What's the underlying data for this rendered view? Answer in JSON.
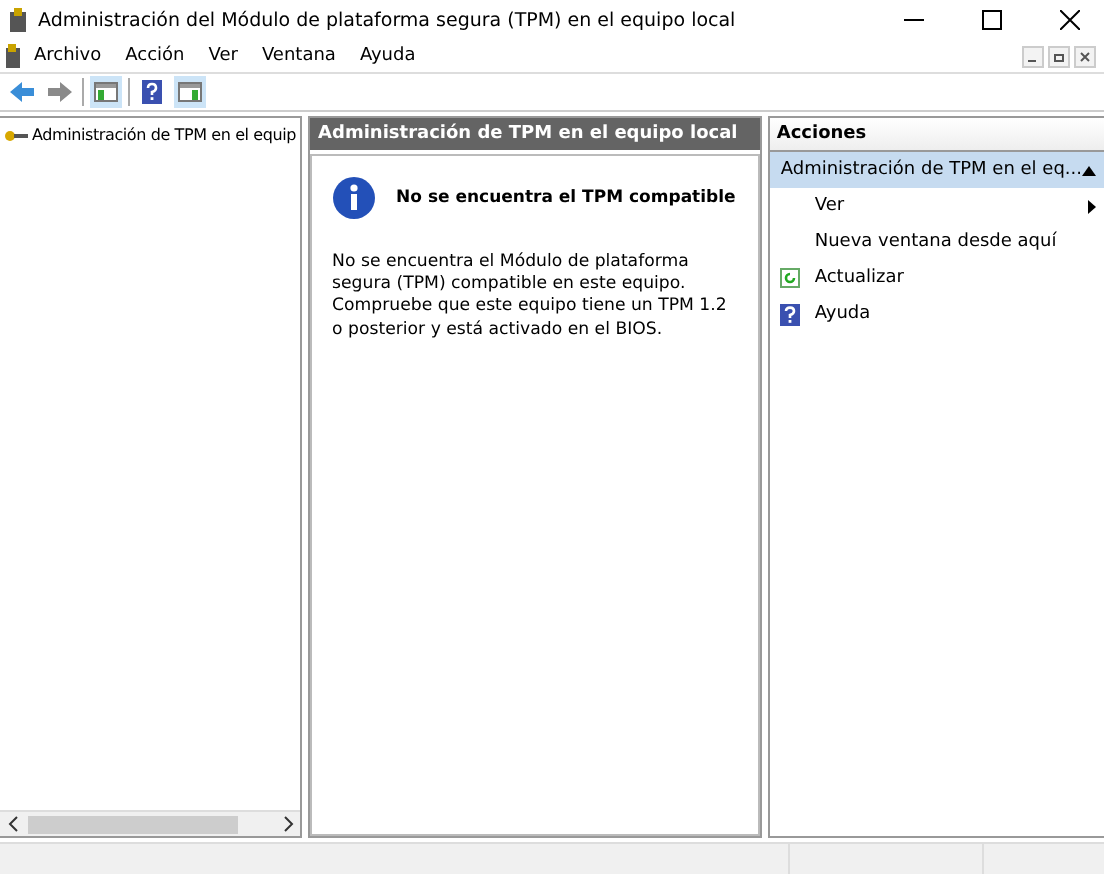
{
  "window": {
    "title": "Administración del Módulo de plataforma segura (TPM) en el equipo local"
  },
  "menu": [
    "Archivo",
    "Acción",
    "Ver",
    "Ventana",
    "Ayuda"
  ],
  "tree": {
    "items": [
      {
        "label": "Administración de TPM en el equip",
        "selected": false
      }
    ]
  },
  "result": {
    "header": "Administración de TPM en el equipo local",
    "message_title": "No se encuentra el TPM compatible",
    "message": "No se encuentra el Módulo de plataforma segura (TPM) compatible en este equipo. Compruebe que este equipo tiene un TPM 1.2 o posterior y está activado en el BIOS."
  },
  "actions": {
    "title": "Acciones",
    "items": [
      {
        "kind": "group",
        "label": "Administración de TPM en el eq...",
        "expanded": true
      },
      {
        "kind": "submenu",
        "label": "Ver"
      },
      {
        "kind": "plain",
        "label": "Nueva ventana desde aquí"
      },
      {
        "kind": "refresh",
        "label": "Actualizar"
      },
      {
        "kind": "help",
        "label": "Ayuda"
      }
    ]
  }
}
